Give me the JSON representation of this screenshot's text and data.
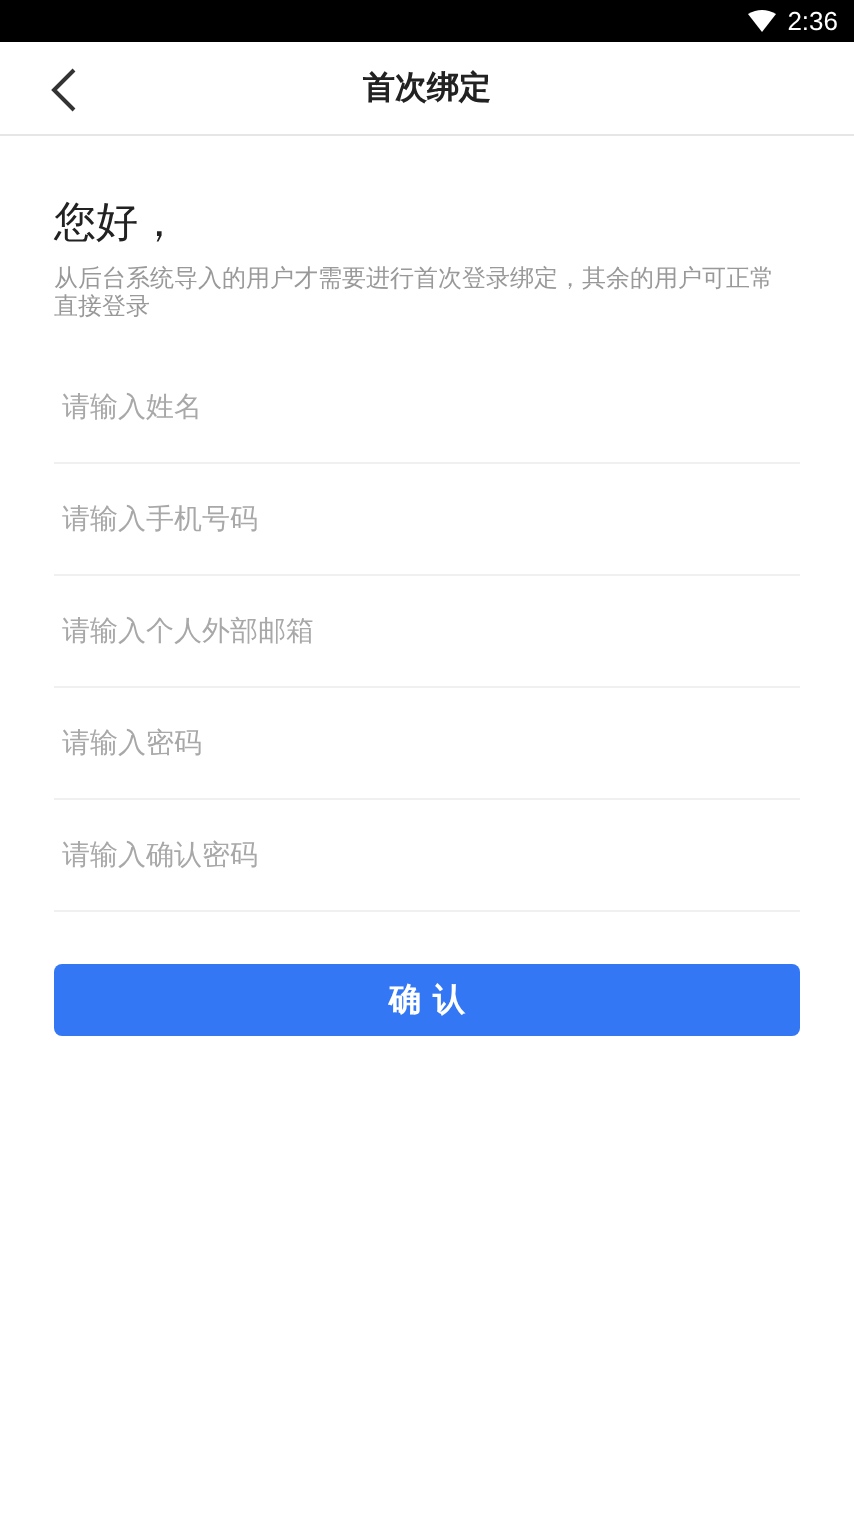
{
  "status_bar": {
    "time": "2:36"
  },
  "header": {
    "title": "首次绑定"
  },
  "greeting": "您好，",
  "description": "从后台系统导入的用户才需要进行首次登录绑定，其余的用户可正常直接登录",
  "fields": [
    {
      "placeholder": "请输入姓名"
    },
    {
      "placeholder": "请输入手机号码"
    },
    {
      "placeholder": "请输入个人外部邮箱"
    },
    {
      "placeholder": "请输入密码"
    },
    {
      "placeholder": "请输入确认密码"
    }
  ],
  "confirm_button": "确 认"
}
